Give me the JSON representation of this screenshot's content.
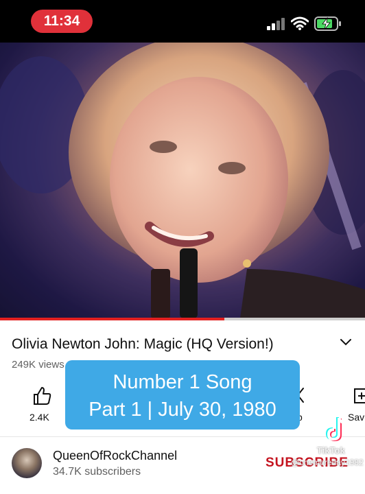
{
  "status_bar": {
    "time": "11:34",
    "time_pill_color": "#e0313a",
    "icons": [
      "signal-icon",
      "wifi-icon",
      "battery-charging-icon"
    ]
  },
  "video": {
    "progress_fraction": 0.615,
    "progress_color": "#e32020"
  },
  "video_info": {
    "title": "Olivia Newton John: Magic (HQ Version!)",
    "views": "249K views · 1",
    "expand_icon": "chevron-down-icon"
  },
  "actions": [
    {
      "icon": "thumbs-up-icon",
      "label": "2.4K"
    },
    {
      "icon": "clip-icon",
      "label": "p"
    },
    {
      "icon": "save-to-playlist-icon",
      "label": "Sav"
    }
  ],
  "caption_overlay": {
    "line1": "Number 1 Song",
    "line2": "Part 1 | July 30, 1980",
    "background_color": "#3fa9e6"
  },
  "channel": {
    "name": "QueenOfRockChannel",
    "subscribers": "34.7K subscribers",
    "subscribe_label": "SUBSCRIBE",
    "subscribe_color": "#c4131f"
  },
  "watermark": {
    "logo": "tiktok-logo-icon",
    "brand": "TikTok",
    "username": "@onemoreday1982"
  }
}
